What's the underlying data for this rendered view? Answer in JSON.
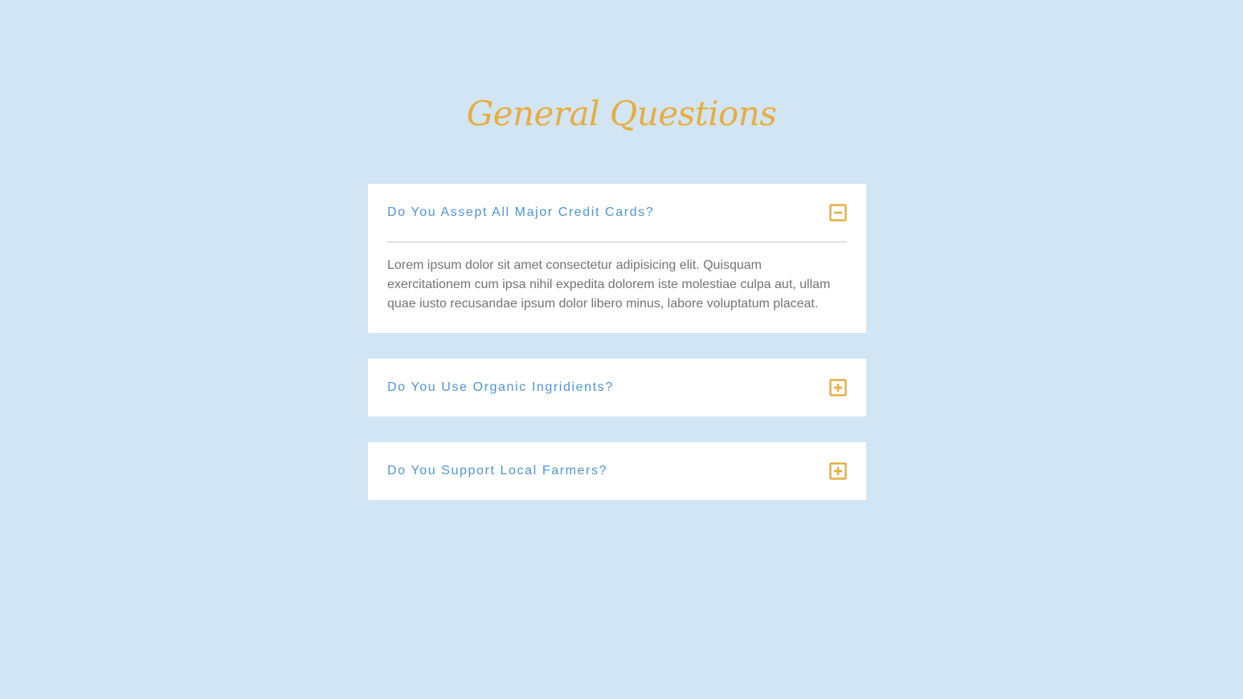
{
  "title": "General Questions",
  "faq": {
    "items": [
      {
        "question": "Do You Assept All Major Credit Cards?",
        "expanded": true,
        "toggle_icon": "minus-square-icon",
        "answer": "Lorem ipsum dolor sit amet consectetur adipisicing elit. Quisquam exercitationem cum ipsa nihil expedita dolorem iste molestiae culpa aut, ullam quae iusto recusandae ipsum dolor libero minus, labore voluptatum placeat."
      },
      {
        "question": "Do You Use Organic Ingridients?",
        "expanded": false,
        "toggle_icon": "plus-square-icon"
      },
      {
        "question": "Do You Support Local Farmers?",
        "expanded": false,
        "toggle_icon": "plus-square-icon"
      }
    ]
  },
  "colors": {
    "background": "#d1e5f5",
    "title": "#e8ad3e",
    "question": "#4e95d6",
    "icon": "#e8ad3e",
    "answer": "#747474",
    "card": "#ffffff"
  }
}
